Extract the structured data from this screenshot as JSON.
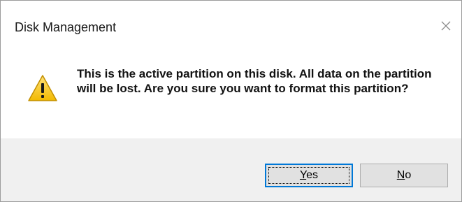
{
  "dialog": {
    "title": "Disk Management",
    "close_icon": "close-icon",
    "icon": "warning-icon",
    "message": "This is the active partition on this disk. All data on the partition will be lost. Are you sure you want to format this partition?",
    "buttons": {
      "yes_label": "Yes",
      "yes_mnemonic": "Y",
      "no_label": "No",
      "no_mnemonic": "N"
    }
  },
  "colors": {
    "footer_bg": "#f0f0f0",
    "default_button_border": "#0078d7",
    "warning_yellow": "#f5c400"
  }
}
